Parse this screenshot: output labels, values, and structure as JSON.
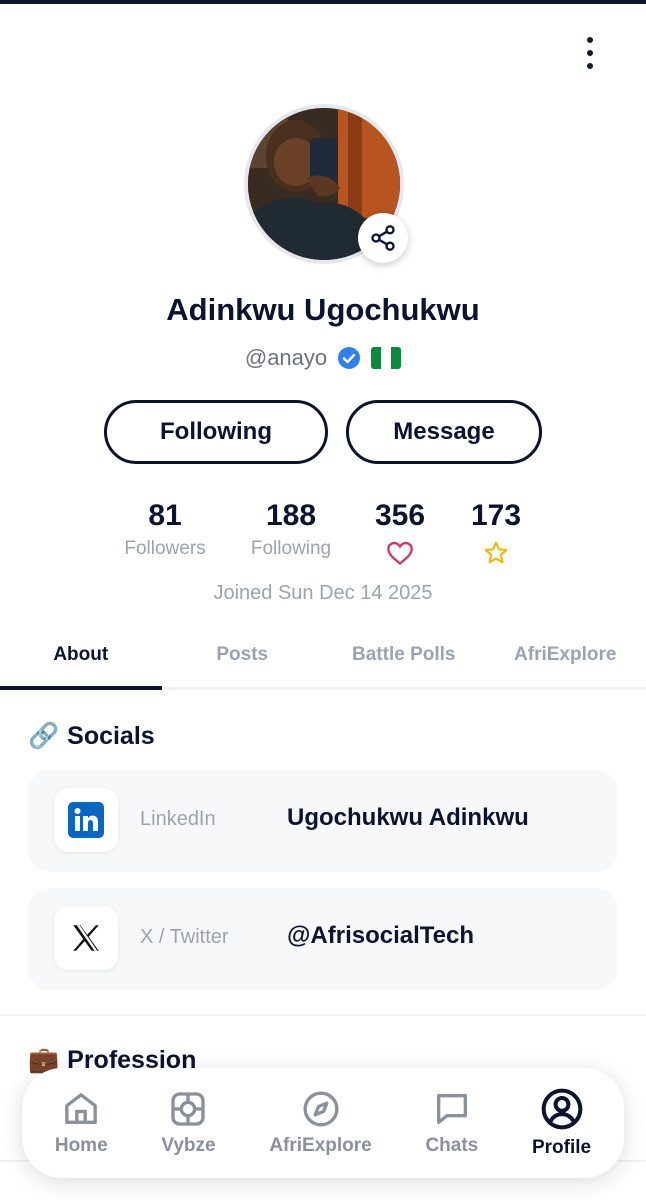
{
  "header": {
    "menu_icon": "more-vertical-icon"
  },
  "profile": {
    "name": "Adinkwu Ugochukwu",
    "handle": "@anayo",
    "verified_icon": "verified-badge-icon",
    "flag_icon": "nigeria-flag-icon",
    "share_icon": "share-icon"
  },
  "actions": {
    "following_label": "Following",
    "message_label": "Message"
  },
  "stats": {
    "followers_count": "81",
    "followers_label": "Followers",
    "following_count": "188",
    "following_label": "Following",
    "likes_count": "356",
    "likes_icon": "heart-icon",
    "stars_count": "173",
    "stars_icon": "star-icon"
  },
  "joined_text": "Joined Sun Dec 14 2025",
  "tabs": [
    {
      "label": "About",
      "active": true
    },
    {
      "label": "Posts",
      "active": false
    },
    {
      "label": "Battle Polls",
      "active": false
    },
    {
      "label": "AfriExplore",
      "active": false
    }
  ],
  "socials": {
    "title": "Socials",
    "title_emoji": "🔗",
    "items": [
      {
        "platform": "LinkedIn",
        "value": "Ugochukwu Adinkwu",
        "icon": "linkedin-icon"
      },
      {
        "platform": "X / Twitter",
        "value": "@AfrisocialTech",
        "icon": "x-twitter-icon"
      }
    ]
  },
  "profession": {
    "title": "Profession",
    "title_emoji": "💼"
  },
  "bottom_nav": [
    {
      "label": "Home",
      "icon": "home-icon",
      "active": false
    },
    {
      "label": "Vybze",
      "icon": "vybze-icon",
      "active": false
    },
    {
      "label": "AfriExplore",
      "icon": "compass-icon",
      "active": false
    },
    {
      "label": "Chats",
      "icon": "chat-icon",
      "active": false
    },
    {
      "label": "Profile",
      "icon": "profile-icon",
      "active": true
    }
  ],
  "colors": {
    "primary": "#0c1330",
    "muted": "#9ca3af",
    "heart": "#d6336c",
    "star": "#f2b705",
    "linkedin": "#0a66c2",
    "verified": "#2f80ed"
  }
}
